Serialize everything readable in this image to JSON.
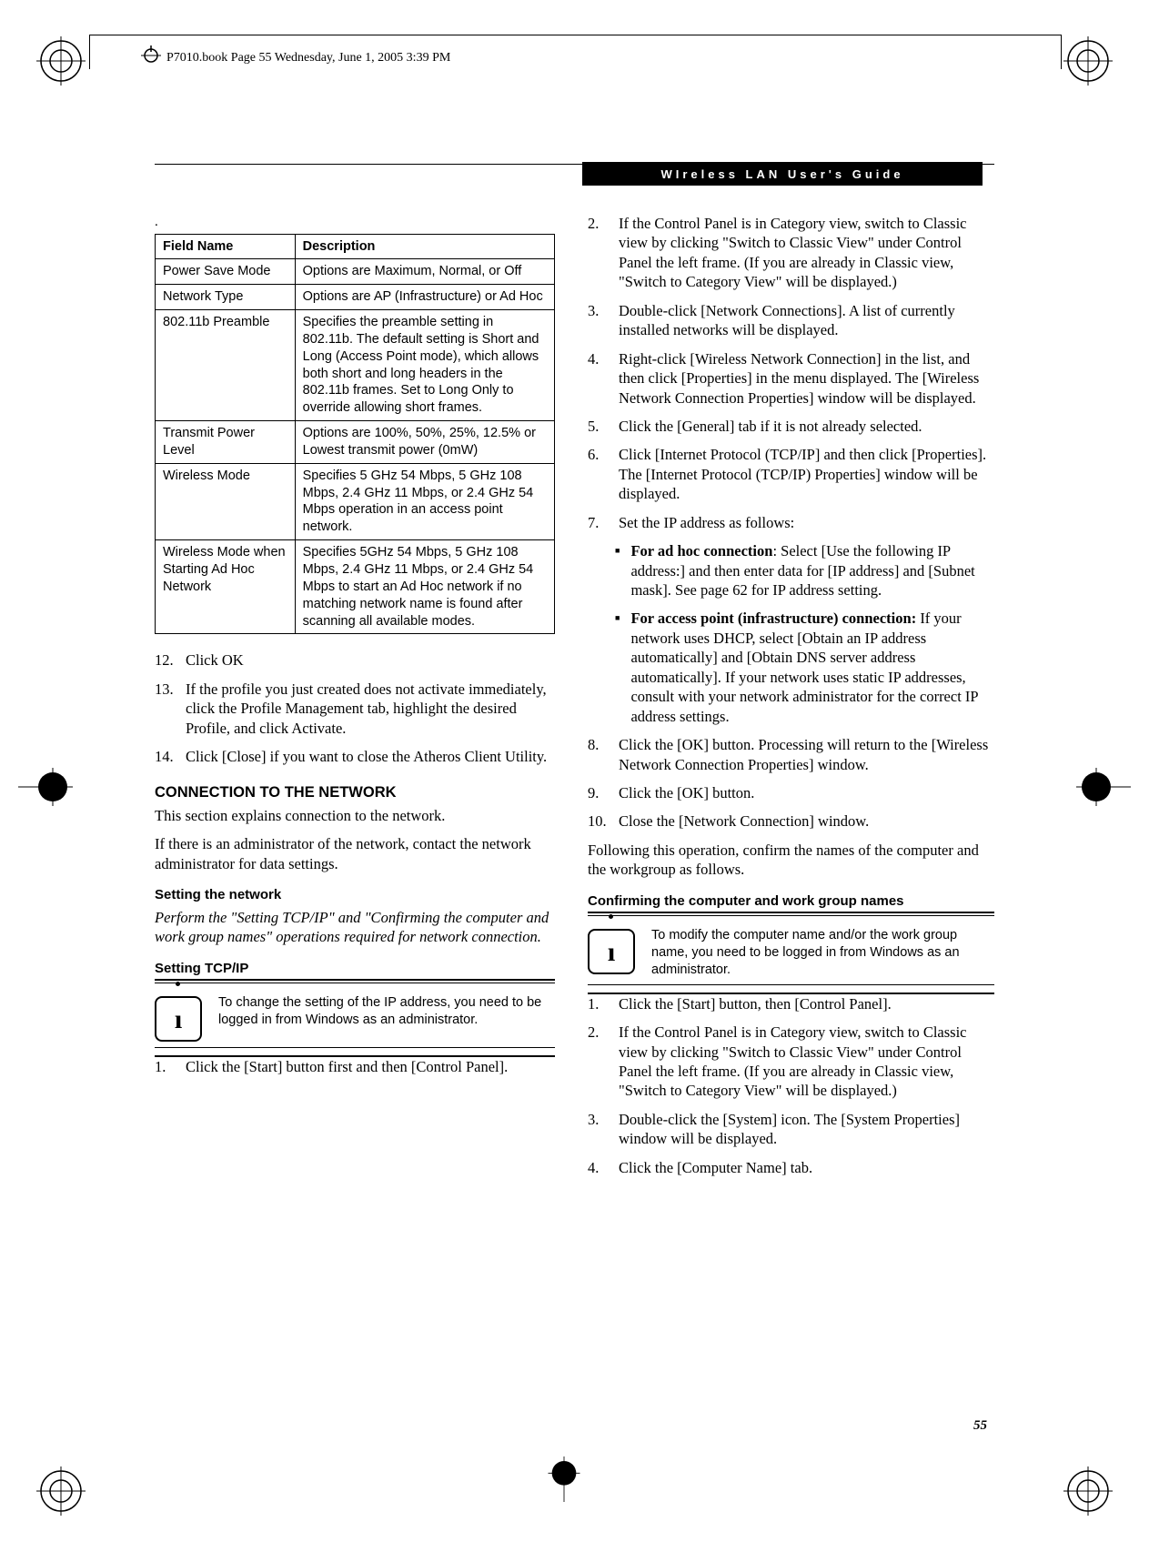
{
  "book_header": "P7010.book  Page 55  Wednesday, June 1, 2005  3:39 PM",
  "guide_title": "WIreless LAN User's Guide",
  "dot_marker": ".",
  "table": {
    "headers": {
      "name": "Field Name",
      "desc": "Description"
    },
    "rows": [
      {
        "name": "Power Save Mode",
        "desc": "Options are Maximum, Normal, or Off"
      },
      {
        "name": "Network Type",
        "desc": "Options are AP (Infrastructure) or Ad Hoc"
      },
      {
        "name": "802.11b Preamble",
        "desc": "Specifies the preamble setting in 802.11b. The default setting is Short and Long (Access Point mode), which allows both short and long headers in the 802.11b frames. Set to Long Only to override allowing short frames."
      },
      {
        "name": "Transmit Power Level",
        "desc": "Options are 100%, 50%, 25%, 12.5% or Lowest transmit power (0mW)"
      },
      {
        "name": "Wireless Mode",
        "desc": "Specifies 5 GHz 54 Mbps, 5 GHz 108 Mbps, 2.4 GHz 11 Mbps, or 2.4 GHz 54 Mbps operation in an access point network."
      },
      {
        "name": "Wireless Mode when Starting Ad Hoc Network",
        "desc": "Specifies 5GHz 54 Mbps, 5 GHz 108 Mbps, 2.4 GHz 11 Mbps, or 2.4 GHz 54 Mbps to start an Ad Hoc network if no matching network name is found after scanning all available modes."
      }
    ]
  },
  "left_list": {
    "start": 12,
    "items": [
      "Click OK",
      "If the profile you just created does not activate immediately, click the Profile Management tab, highlight the desired Profile, and click Activate.",
      "Click [Close] if you want to close the Atheros Client Utility."
    ]
  },
  "section_heading": "CONNECTION TO THE NETWORK",
  "section_intro": "This section explains connection to the network.",
  "section_admin": "If there is an administrator of the network, contact the network administrator for data settings.",
  "setting_network_heading": "Setting the network",
  "setting_network_body": "Perform the \"Setting TCP/IP\" and \"Confirming the computer and work group names\" operations required for network connection.",
  "setting_tcpip_heading": "Setting TCP/IP",
  "note1": "To change the setting of the IP address, you need to be logged in from Windows as an administrator.",
  "tcpip_list": {
    "item1": "Click the [Start] button first and then [Control Panel]."
  },
  "right_list_top": {
    "items": [
      {
        "n": "2.",
        "t": "If the Control Panel is in Category view, switch to Classic view by clicking \"Switch to Classic View\" under Control Panel the left frame. (If you are already in Classic view, \"Switch to Category View\" will be displayed.)"
      },
      {
        "n": "3.",
        "t": "Double-click [Network Connections]. A list of currently installed networks will be displayed."
      },
      {
        "n": "4.",
        "t": "Right-click [Wireless Network Connection] in the list, and then click [Properties] in the menu displayed. The [Wireless Network Connection Properties] window will be displayed."
      },
      {
        "n": "5.",
        "t": "Click the [General] tab if it is not already selected."
      },
      {
        "n": "6.",
        "t": "Click [Internet Protocol (TCP/IP] and then click [Properties]. The [Internet Protocol (TCP/IP) Properties] window will be displayed."
      },
      {
        "n": "7.",
        "t": "Set the IP address as follows:"
      }
    ]
  },
  "bullets": [
    {
      "lead": "For ad hoc connection",
      "rest": ": Select [Use the following IP address:] and then enter data for [IP address] and [Subnet mask]. See page 62 for IP address setting."
    },
    {
      "lead": "For access point (infrastructure) connection:",
      "rest": " If your network uses DHCP, select [Obtain an IP address automatically] and [Obtain DNS server address automatically]. If your network uses static IP addresses, consult with your network administrator for the correct IP address settings."
    }
  ],
  "right_list_mid": {
    "items": [
      {
        "n": "8.",
        "t": "Click the [OK] button. Processing will return to the [Wireless Network Connection Properties] window."
      },
      {
        "n": "9.",
        "t": "Click the [OK] button."
      },
      {
        "n": "10.",
        "t": "Close the [Network Connection] window."
      }
    ]
  },
  "following_text": "Following this operation, confirm the names of the computer and the workgroup as follows.",
  "confirm_heading": "Confirming the computer and work group names",
  "note2": "To modify the computer name and/or the work group name, you need to be logged in from Windows as an administrator.",
  "right_list_bottom": {
    "items": [
      {
        "n": "1.",
        "t": "Click the [Start] button, then [Control Panel]."
      },
      {
        "n": "2.",
        "t": "If the Control Panel is in Category view, switch to Classic view by clicking \"Switch to Classic View\" under Control Panel the left frame. (If you are already in Classic view, \"Switch to Category View\" will be displayed.)"
      },
      {
        "n": "3.",
        "t": "Double-click the [System] icon. The [System Properties] window will be displayed."
      },
      {
        "n": "4.",
        "t": "Click the [Computer Name] tab."
      }
    ]
  },
  "page_number": "55"
}
